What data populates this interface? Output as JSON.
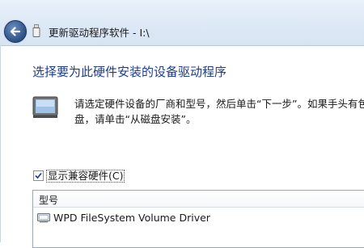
{
  "window": {
    "title": "更新驱动程序软件 - I:\\"
  },
  "page": {
    "heading": "选择要为此硬件安装的设备驱动程序",
    "description_line1": "请选定硬件设备的厂商和型号，然后单击“下一步”。如果手头有包",
    "description_line2": "盘，请单击“从磁盘安装”。"
  },
  "compat_checkbox": {
    "label": "显示兼容硬件(C)",
    "checked": true
  },
  "model_list": {
    "header": "型号",
    "items": [
      {
        "label": "WPD FileSystem Volume Driver",
        "icon": "device-driver-icon"
      }
    ]
  },
  "colors": {
    "heading": "#1d3d8f",
    "titlebar": "#dce8f5",
    "back_button": "#2c4f86"
  }
}
